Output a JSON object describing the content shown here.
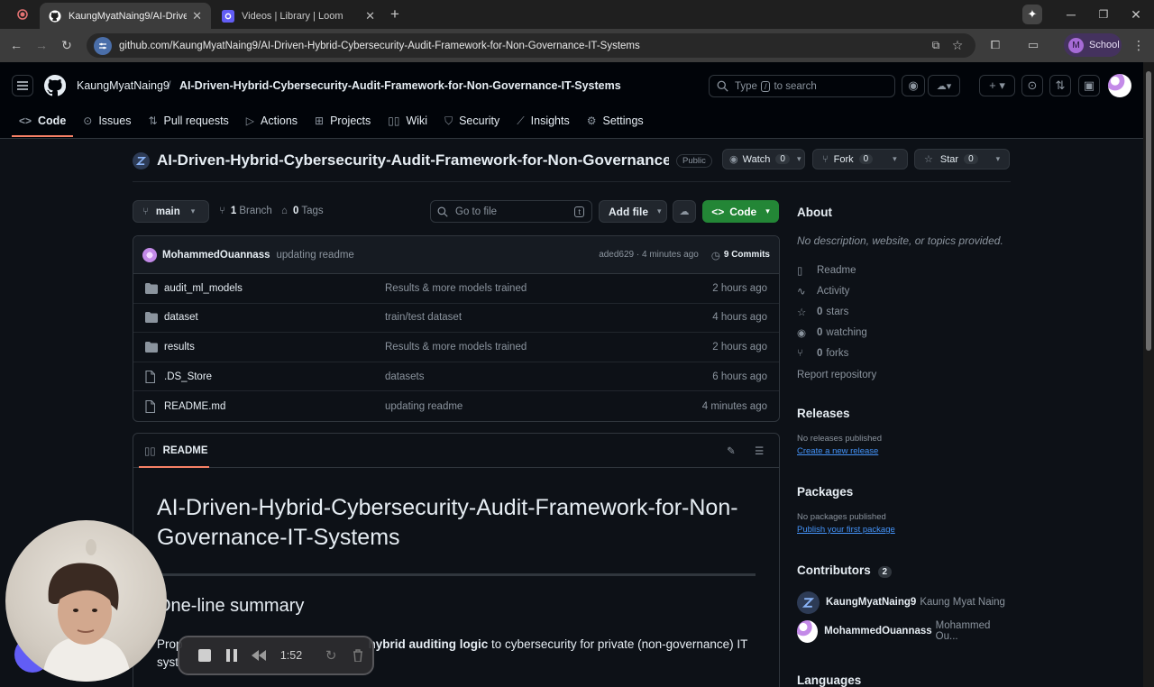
{
  "browser": {
    "tabs": [
      {
        "title": "KaungMyatNaing9/AI-Drive",
        "active": true
      },
      {
        "title": "Videos | Library | Loom",
        "active": false
      }
    ],
    "url": "github.com/KaungMyatNaing9/AI-Driven-Hybrid-Cybersecurity-Audit-Framework-for-Non-Governance-IT-Systems",
    "profile_label": "School",
    "profile_initial": "M"
  },
  "header": {
    "owner": "KaungMyatNaing9",
    "repo": "AI-Driven-Hybrid-Cybersecurity-Audit-Framework-for-Non-Governance-IT-Systems",
    "search_prefix": "Type",
    "search_key": "/",
    "search_suffix": "to search"
  },
  "nav": [
    "Code",
    "Issues",
    "Pull requests",
    "Actions",
    "Projects",
    "Wiki",
    "Security",
    "Insights",
    "Settings"
  ],
  "repo_title": {
    "name": "AI-Driven-Hybrid-Cybersecurity-Audit-Framework-for-Non-Governance-IT-S...",
    "visibility": "Public",
    "watch_label": "Watch",
    "watch_count": "0",
    "fork_label": "Fork",
    "fork_count": "0",
    "star_label": "Star",
    "star_count": "0"
  },
  "branch_bar": {
    "branch": "main",
    "branch_count": "1",
    "branch_label": "Branch",
    "tag_count": "0",
    "tag_label": "Tags",
    "goto_placeholder": "Go to file",
    "goto_key": "t",
    "add_file": "Add file",
    "code": "Code"
  },
  "latest_commit": {
    "author": "MohammedOuannass",
    "message": "updating readme",
    "hash_time": "aded629 · 4 minutes ago",
    "commits": "9 Commits"
  },
  "files": [
    {
      "name": "audit_ml_models",
      "type": "dir",
      "message": "Results & more models trained",
      "time": "2 hours ago"
    },
    {
      "name": "dataset",
      "type": "dir",
      "message": "train/test dataset",
      "time": "4 hours ago"
    },
    {
      "name": "results",
      "type": "dir",
      "message": "Results & more models trained",
      "time": "2 hours ago"
    },
    {
      "name": ".DS_Store",
      "type": "file",
      "message": "datasets",
      "time": "6 hours ago"
    },
    {
      "name": "README.md",
      "type": "file",
      "message": "updating readme",
      "time": "4 minutes ago"
    }
  ],
  "readme": {
    "tab": "README",
    "h1": "AI-Driven-Hybrid-Cybersecurity-Audit-Framework-for-Non-Governance-IT-Systems",
    "h2": "One-line summary",
    "p_start": "Prop",
    "p_bold": "hybrid auditing logic",
    "p_end": "to cybersecurity for private (non-governance) IT",
    "p_line2": "syst"
  },
  "about": {
    "title": "About",
    "description": "No description, website, or topics provided.",
    "readme": "Readme",
    "activity": "Activity",
    "stars_count": "0",
    "stars_label": "stars",
    "watching_count": "0",
    "watching_label": "watching",
    "forks_count": "0",
    "forks_label": "forks",
    "report": "Report repository"
  },
  "releases": {
    "title": "Releases",
    "empty": "No releases published",
    "link": "Create a new release"
  },
  "packages": {
    "title": "Packages",
    "empty": "No packages published",
    "link": "Publish your first package"
  },
  "contributors": {
    "title": "Contributors",
    "count": "2",
    "list": [
      {
        "login": "KaungMyatNaing9",
        "name": "Kaung Myat Naing"
      },
      {
        "login": "MohammedOuannass",
        "name": "Mohammed Ou..."
      }
    ]
  },
  "languages": {
    "title": "Languages"
  },
  "recorder": {
    "time": "1:52"
  },
  "colors": {
    "accent": "#f78166",
    "green": "#238636",
    "link": "#4493f8",
    "bg": "#0d1117"
  }
}
